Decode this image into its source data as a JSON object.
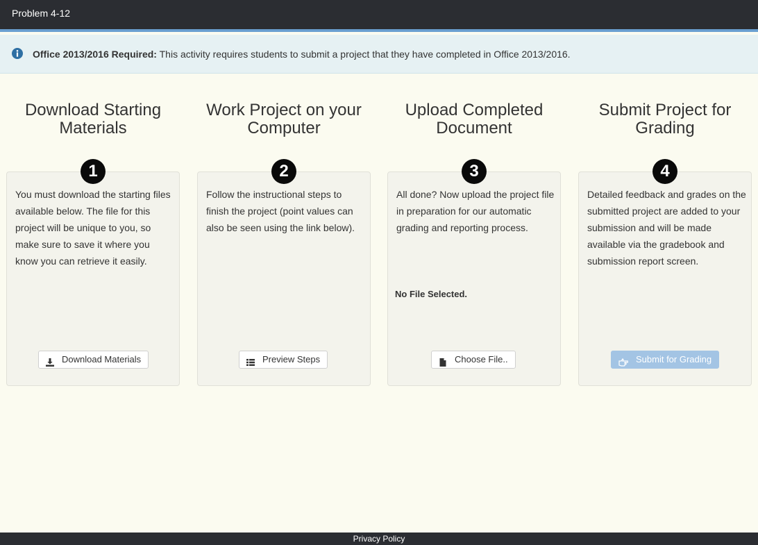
{
  "header": {
    "title": "Problem 4-12"
  },
  "alert": {
    "icon": "info-icon",
    "bold": "Office 2013/2016 Required:",
    "text": " This activity requires students to submit a project that they have completed in Office 2013/2016."
  },
  "steps": [
    {
      "number": "1",
      "title_line1": "Download Starting",
      "title_line2": "Materials",
      "text": "You must download the starting files available below. The file for this project will be unique to you, so make sure to save it where you know you can retrieve it easily.",
      "button_label": "Download Materials",
      "button_icon": "download-icon"
    },
    {
      "number": "2",
      "title_line1": "Work Project on your",
      "title_line2": "Computer",
      "text": "Follow the instructional steps to finish the project (point values can also be seen using the link below).",
      "button_label": "Preview Steps",
      "button_icon": "list-icon"
    },
    {
      "number": "3",
      "title_line1": "Upload Completed",
      "title_line2": "Document",
      "text": "All done? Now upload the project file in preparation for our automatic grading and reporting process.",
      "status": "No File Selected.",
      "button_label": "Choose File..",
      "button_icon": "file-icon"
    },
    {
      "number": "4",
      "title_line1": "Submit Project for",
      "title_line2": "Grading",
      "text": "Detailed feedback and grades on the submitted project are added to your submission and will be made available via the gradebook and submission report screen.",
      "button_label": "Submit for Grading",
      "button_icon": "hand-point-right-icon",
      "button_state": "disabled"
    }
  ],
  "footer": {
    "link": "Privacy Policy"
  },
  "colors": {
    "topbar": "#2b2d32",
    "accent_border": "#6a9fd0",
    "alert_bg": "#e6f1f3",
    "info_icon": "#2e6fa3",
    "disabled_button": "#a3c4e4"
  }
}
